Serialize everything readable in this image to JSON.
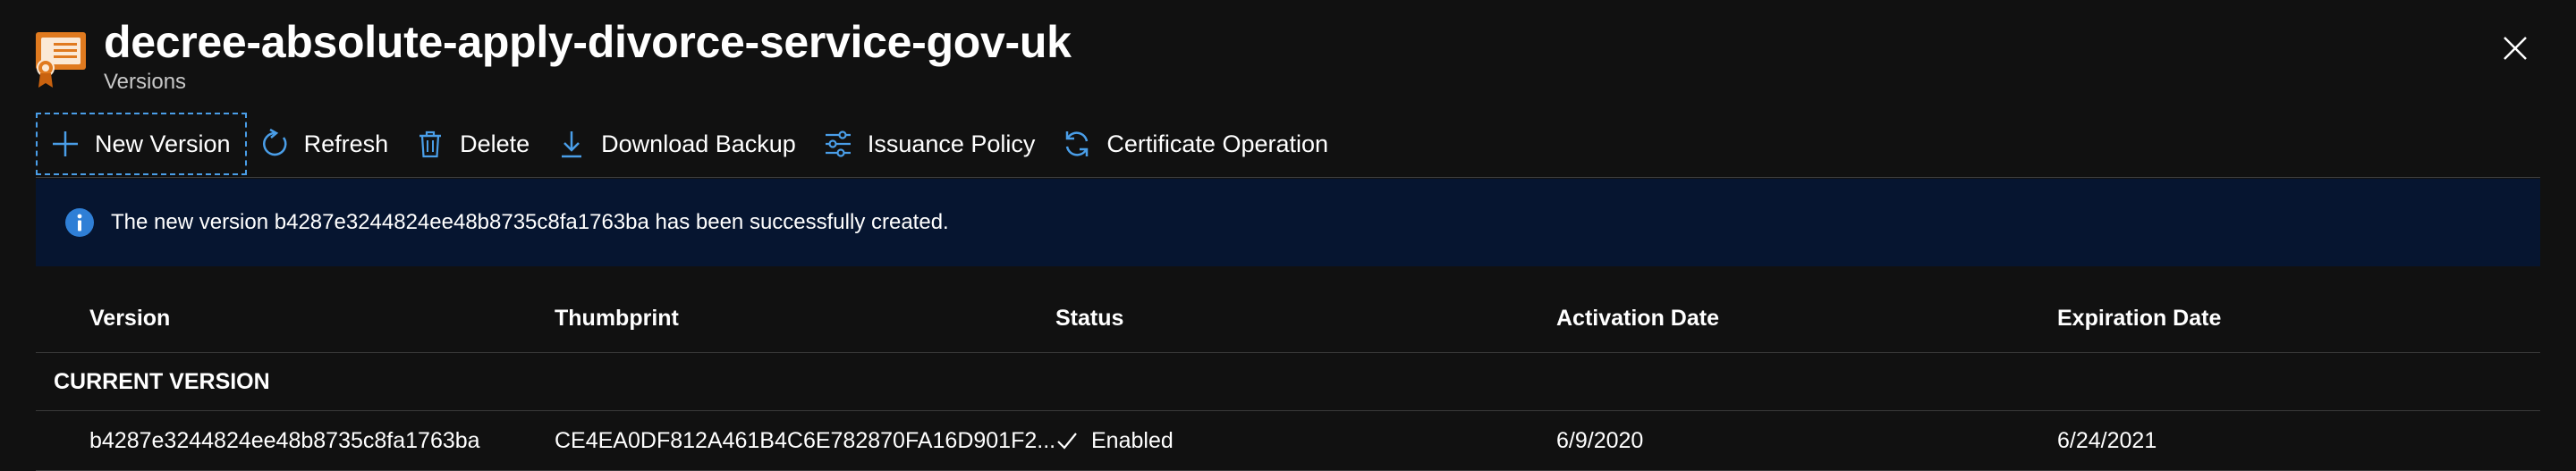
{
  "header": {
    "title": "decree-absolute-apply-divorce-service-gov-uk",
    "subtitle": "Versions"
  },
  "toolbar": {
    "new_version": "New Version",
    "refresh": "Refresh",
    "delete": "Delete",
    "download_backup": "Download Backup",
    "issuance_policy": "Issuance Policy",
    "certificate_operation": "Certificate Operation"
  },
  "banner": {
    "message": "The new version b4287e3244824ee48b8735c8fa1763ba has been successfully created."
  },
  "table": {
    "columns": {
      "version": "Version",
      "thumbprint": "Thumbprint",
      "status": "Status",
      "activation_date": "Activation Date",
      "expiration_date": "Expiration Date"
    },
    "group_label": "CURRENT VERSION",
    "rows": [
      {
        "version": "b4287e3244824ee48b8735c8fa1763ba",
        "thumbprint": "CE4EA0DF812A461B4C6E782870FA16D901F2...",
        "status": "Enabled",
        "activation_date": "6/9/2020",
        "expiration_date": "6/24/2021"
      }
    ]
  },
  "colors": {
    "background": "#111111",
    "banner": "#061530",
    "accent": "#4a9ee8",
    "icon_orange": "#e07a1f"
  }
}
